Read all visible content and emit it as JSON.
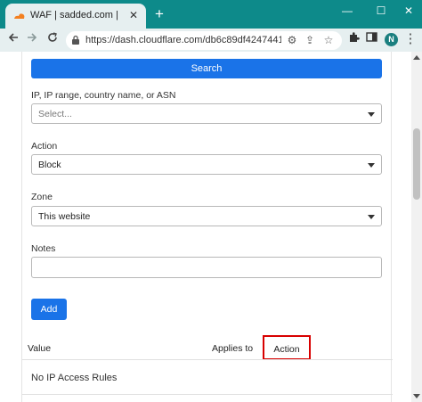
{
  "browser": {
    "tab_title": "WAF | sadded.com |",
    "tab_close": "✕",
    "new_tab": "+",
    "window_buttons": {
      "minimize": "—",
      "maximize": "☐",
      "close": "✕"
    },
    "url": "https://dash.cloudflare.com/db6c89df4247441401...",
    "profile_initial": "N",
    "accent_color": "#0d8a8a"
  },
  "form": {
    "search_label": "Search",
    "ip_label": "IP, IP range, country name, or ASN",
    "ip_placeholder": "Select...",
    "action_label": "Action",
    "action_value": "Block",
    "zone_label": "Zone",
    "zone_value": "This website",
    "notes_label": "Notes",
    "notes_value": "",
    "add_label": "Add"
  },
  "table": {
    "columns": [
      "Value",
      "Applies to",
      "Action"
    ],
    "empty_message": "No IP Access Rules"
  }
}
